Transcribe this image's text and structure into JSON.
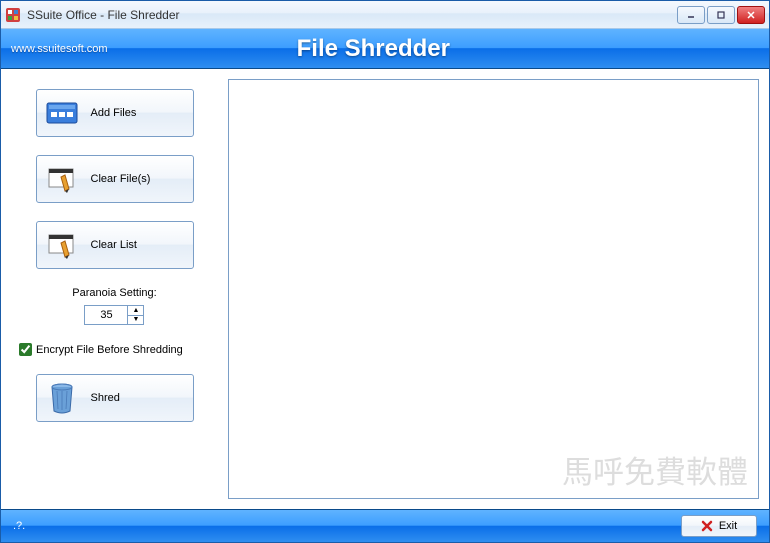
{
  "window": {
    "title": "SSuite Office - File Shredder"
  },
  "header": {
    "url": "www.ssuitesoft.com",
    "app_title": "File Shredder"
  },
  "sidebar": {
    "add_files_label": "Add Files",
    "clear_files_label": "Clear File(s)",
    "clear_list_label": "Clear List",
    "paranoia_label": "Paranoia Setting:",
    "paranoia_value": "35",
    "encrypt_label": "Encrypt File Before Shredding",
    "encrypt_checked": true,
    "shred_label": "Shred"
  },
  "footer": {
    "status": ".?.",
    "exit_label": "Exit"
  },
  "watermark": "馬呼免費軟體"
}
